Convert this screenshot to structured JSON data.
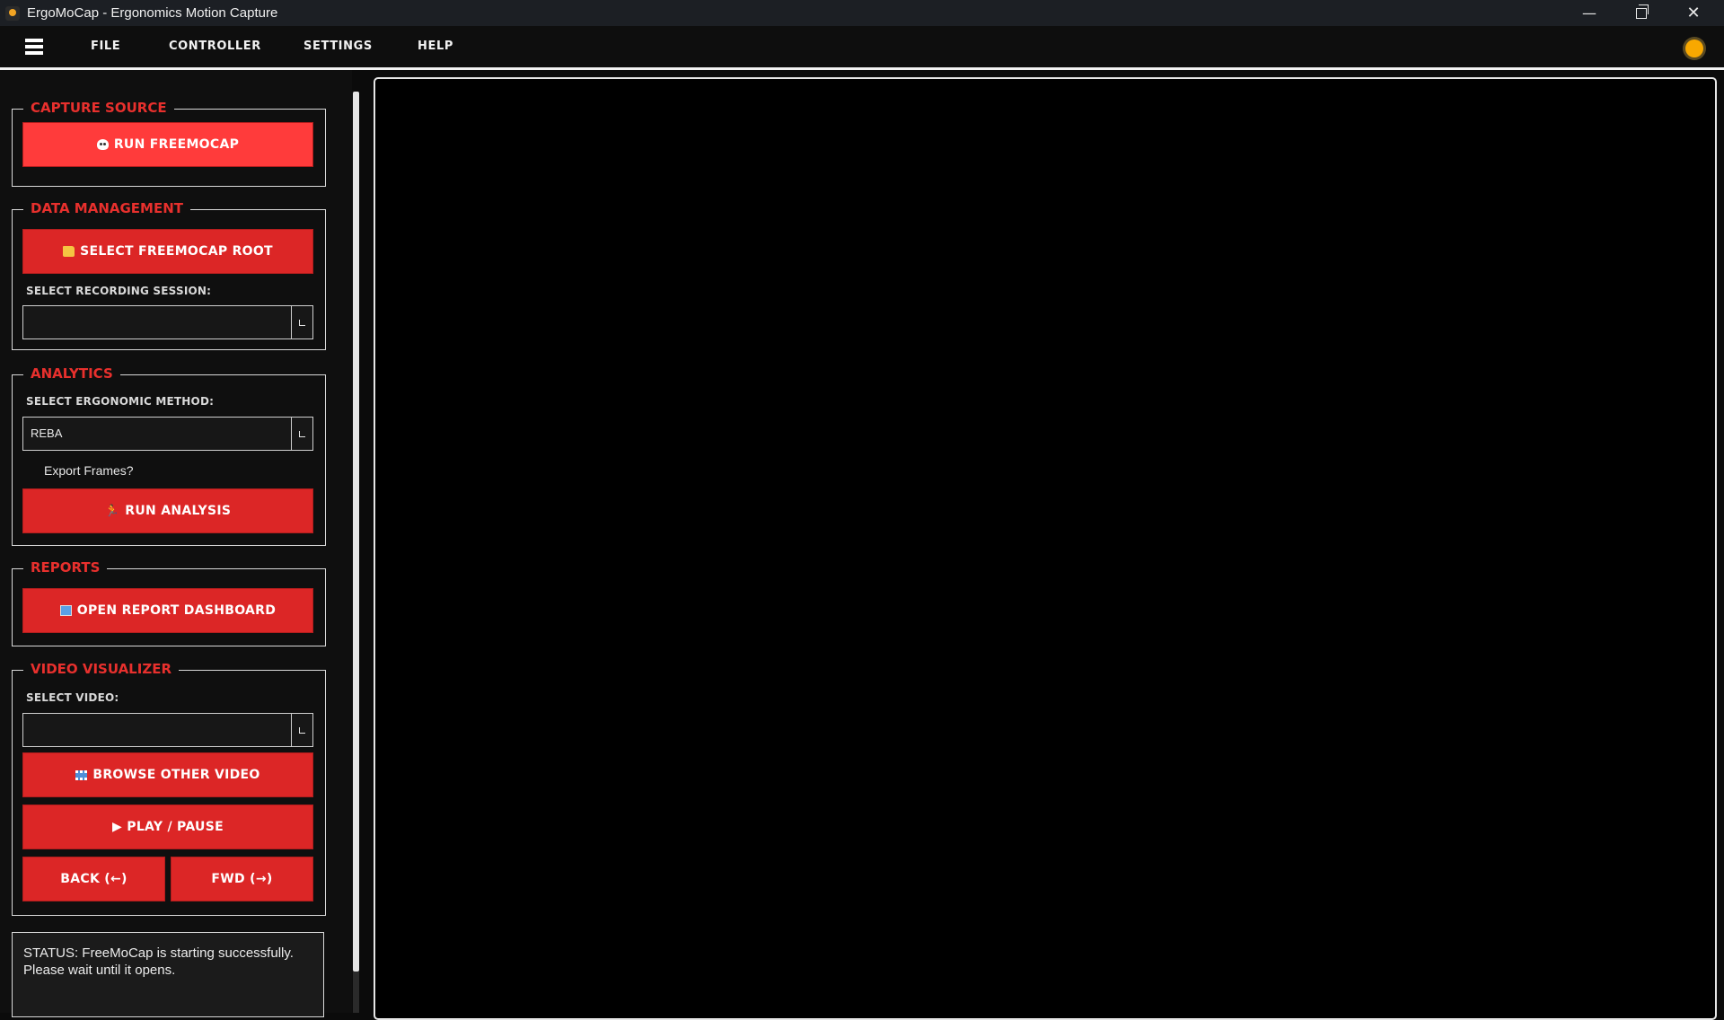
{
  "window": {
    "title": "ErgoMoCap - Ergonomics Motion Capture",
    "minimize": "—",
    "close": "✕"
  },
  "menu": {
    "items": [
      "FILE",
      "CONTROLLER",
      "SETTINGS",
      "HELP"
    ]
  },
  "sidebar": {
    "capture_source": {
      "title": "CAPTURE SOURCE",
      "run_button": "RUN FREEMOCAP"
    },
    "data_management": {
      "title": "DATA MANAGEMENT",
      "select_root_button": "SELECT FREEMOCAP ROOT",
      "session_label": "SELECT RECORDING SESSION:",
      "session_value": ""
    },
    "analytics": {
      "title": "ANALYTICS",
      "method_label": "SELECT ERGONOMIC METHOD:",
      "method_value": "REBA",
      "export_frames_label": "Export Frames?",
      "run_button": "RUN ANALYSIS"
    },
    "reports": {
      "title": "REPORTS",
      "dashboard_button": "OPEN REPORT DASHBOARD"
    },
    "video_visualizer": {
      "title": "VIDEO VISUALIZER",
      "video_label": "SELECT VIDEO:",
      "video_value": "",
      "browse_button": "BROWSE OTHER VIDEO",
      "play_button": "▶ PLAY / PAUSE",
      "back_button": "BACK (←)",
      "fwd_button": "FWD (→)"
    },
    "status": {
      "text": "STATUS: FreeMoCap is starting successfully. Please wait until it opens."
    }
  },
  "colors": {
    "accent": "#dc2626",
    "accent_bright": "#ff3b3b",
    "section_title": "#e8302d",
    "background": "#0b0b0b"
  },
  "icons": [
    "hamburger-icon",
    "sun-icon",
    "skull-icon",
    "folder-icon",
    "runner-icon",
    "chart-icon",
    "film-icon"
  ]
}
